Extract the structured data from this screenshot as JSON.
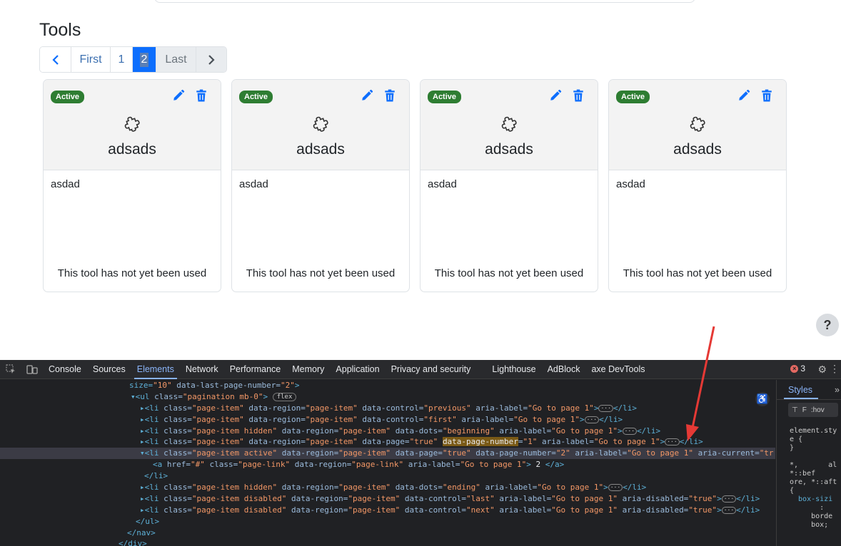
{
  "page": {
    "title": "Tools",
    "pagination": {
      "prev_icon": "chevron-left-icon",
      "first_label": "First",
      "page1_label": "1",
      "page2_label": "2",
      "last_label": "Last",
      "next_icon": "chevron-right-icon",
      "current_page": 2
    },
    "cards": [
      {
        "status": "Active",
        "name": "adsads",
        "description": "asdad",
        "usage": "This tool has not yet been used"
      },
      {
        "status": "Active",
        "name": "adsads",
        "description": "asdad",
        "usage": "This tool has not yet been used"
      },
      {
        "status": "Active",
        "name": "adsads",
        "description": "asdad",
        "usage": "This tool has not yet been used"
      },
      {
        "status": "Active",
        "name": "adsads",
        "description": "asdad",
        "usage": "This tool has not yet been used"
      }
    ],
    "help_label": "?"
  },
  "devtools": {
    "tabs": [
      "Console",
      "Sources",
      "Elements",
      "Network",
      "Performance",
      "Memory",
      "Application",
      "Privacy and security",
      "Lighthouse",
      "AdBlock",
      "axe DevTools"
    ],
    "active_tab": "Elements",
    "error_count": "3",
    "styles_tab": "Styles",
    "styles_filter": "F",
    "styles_hov": ":hov",
    "styles_lines": [
      "element.sty",
      "e {",
      "}",
      "",
      "*,       al",
      "*::bef",
      "ore, *::aft",
      "{",
      "  box-sizi",
      "       :",
      "     borde",
      "     box;"
    ],
    "code_lines": [
      "        size=\"10\" data-last-page-number=\"2\">",
      "      ▾<ul class=\"pagination mb-0\">",
      "        ▸<li class=\"page-item\" data-region=\"page-item\" data-control=\"previous\" aria-label=\"Go to page 1\">",
      "        ▸<li class=\"page-item\" data-region=\"page-item\" data-control=\"first\" aria-label=\"Go to page 1\">",
      "        ▸<li class=\"page-item hidden\" data-region=\"page-item\" data-dots=\"beginning\" aria-label=\"Go to page 1\">",
      "        ▸<li class=\"page-item\" data-region=\"page-item\" data-page=\"true\" data-page-number=\"1\" aria-label=\"Go to page 1\">",
      "        ▾<li class=\"page-item active\" data-region=\"page-item\" data-page=\"true\" data-page-number=\"2\" aria-label=\"Go to page 1\" aria-current=\"tr",
      "            <a href=\"#\" class=\"page-link\" data-region=\"page-link\" aria-label=\"Go to page 1\"> 2 </a>",
      "          </li>",
      "        ▸<li class=\"page-item hidden\" data-region=\"page-item\" data-dots=\"ending\" aria-label=\"Go to page 1\">",
      "        ▸<li class=\"page-item disabled\" data-region=\"page-item\" data-control=\"last\" aria-label=\"Go to page 1\" aria-disabled=\"true\">",
      "        ▸<li class=\"page-item disabled\" data-region=\"page-item\" data-control=\"next\" aria-label=\"Go to page 1\" aria-disabled=\"true\">",
      "        </ul>",
      "      </nav>",
      "    </div>"
    ],
    "flex_badge": "flex",
    "highlight_text": "data-page-number"
  },
  "colors": {
    "primary": "#0d6efd",
    "active_badge": "#2e7d32",
    "devtools_bg": "#202124",
    "arrow": "#e53935"
  }
}
